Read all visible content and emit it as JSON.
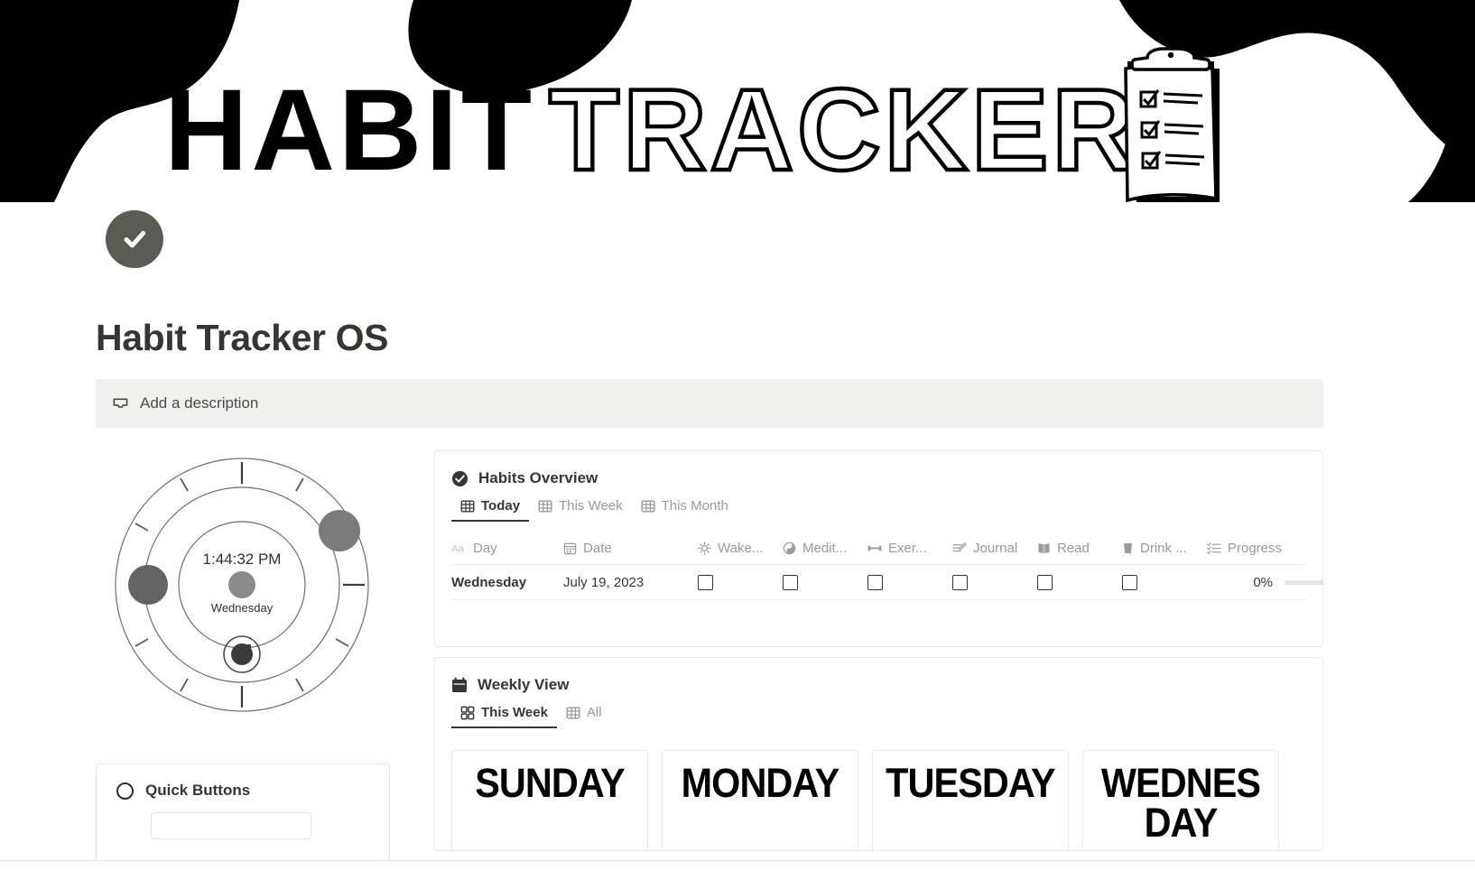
{
  "banner": {
    "title_part_filled": "HABIT",
    "title_part_outline": "TRACKER",
    "illustration": "clipboard-checklist-illustration"
  },
  "page": {
    "icon": "check-circle-icon",
    "title": "Habit Tracker OS",
    "description_placeholder": "Add a description",
    "description_icon": "description-icon"
  },
  "clock": {
    "time": "1:44:32 PM",
    "day": "Wednesday"
  },
  "quick_buttons": {
    "icon": "circle-icon",
    "title": "Quick Buttons"
  },
  "habits_overview": {
    "icon": "check-circle-icon",
    "title": "Habits Overview",
    "tabs": [
      {
        "label": "Today",
        "icon": "table-icon",
        "active": true
      },
      {
        "label": "This Week",
        "icon": "table-icon",
        "active": false
      },
      {
        "label": "This Month",
        "icon": "table-icon",
        "active": false
      }
    ],
    "columns": [
      {
        "label": "Day",
        "icon": "title-aa-icon"
      },
      {
        "label": "Date",
        "icon": "calendar-icon"
      },
      {
        "label": "Wake...",
        "icon": "sun-icon"
      },
      {
        "label": "Medit...",
        "icon": "yin-yang-icon"
      },
      {
        "label": "Exer...",
        "icon": "dumbbell-icon"
      },
      {
        "label": "Journal",
        "icon": "pencil-lines-icon"
      },
      {
        "label": "Read",
        "icon": "book-icon"
      },
      {
        "label": "Drink ...",
        "icon": "glass-icon"
      },
      {
        "label": "Progress",
        "icon": "checklist-icon"
      }
    ],
    "rows": [
      {
        "day": "Wednesday",
        "date": "July 19, 2023",
        "wake_up": false,
        "meditate": false,
        "exercise": false,
        "journal": false,
        "read": false,
        "drink_water": false,
        "progress_label": "0%",
        "progress_value": 0
      }
    ]
  },
  "weekly_view": {
    "icon": "calendar-icon",
    "title": "Weekly View",
    "tabs": [
      {
        "label": "This Week",
        "icon": "gallery-icon",
        "active": true
      },
      {
        "label": "All",
        "icon": "table-icon",
        "active": false
      }
    ],
    "days": [
      {
        "name": "SUNDAY"
      },
      {
        "name": "MONDAY"
      },
      {
        "name": "TUESDAY"
      },
      {
        "name": "WEDNESDAY"
      }
    ]
  },
  "colors": {
    "text": "#37352f",
    "muted": "#9b9a97",
    "icon_bg": "#5b5b55",
    "border": "#e9e9e7",
    "desc_bg": "#f1f1ef"
  }
}
